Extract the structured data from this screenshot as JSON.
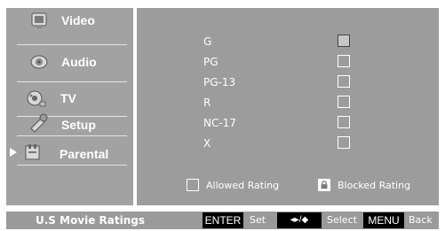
{
  "menu": {
    "items": [
      {
        "label": "Video",
        "icon": "video-icon"
      },
      {
        "label": "Audio",
        "icon": "audio-icon"
      },
      {
        "label": "TV",
        "icon": "tv-icon"
      },
      {
        "label": "Setup",
        "icon": "setup-icon"
      },
      {
        "label": "Parental",
        "icon": "parental-icon",
        "selected": true
      }
    ]
  },
  "ratings": {
    "items": [
      {
        "label": "G",
        "state": "allowed",
        "focused": true
      },
      {
        "label": "PG",
        "state": "allowed"
      },
      {
        "label": "PG-13",
        "state": "allowed"
      },
      {
        "label": "R",
        "state": "allowed"
      },
      {
        "label": "NC-17",
        "state": "allowed"
      },
      {
        "label": "X",
        "state": "allowed"
      }
    ]
  },
  "legend": {
    "allowed_label": "Allowed Rating",
    "blocked_label": "Blocked Rating"
  },
  "bottom_bar": {
    "title": "U.S Movie Ratings",
    "enter_key": "ENTER",
    "enter_action": "Set",
    "arrows_key": "◂▸/◆",
    "arrows_action": "Select",
    "menu_key": "MENU",
    "menu_action": "Back"
  },
  "colors": {
    "panel": "#9c9c9c",
    "menu": "#a2a2a2",
    "text": "#ffffff",
    "key_bg": "#000000"
  }
}
